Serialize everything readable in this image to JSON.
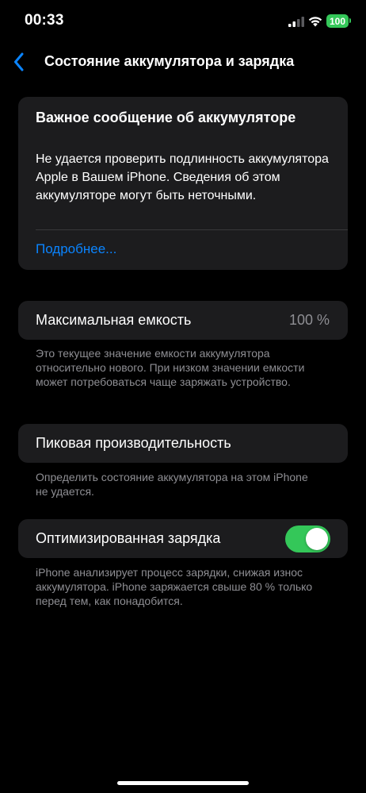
{
  "status_bar": {
    "time": "00:33",
    "battery_level": "100",
    "icons": [
      "signal-icon",
      "wifi-icon",
      "battery-icon"
    ]
  },
  "nav": {
    "back_icon": "chevron-left-icon",
    "title": "Состояние аккумулятора и зарядка"
  },
  "alert": {
    "title": "Важное сообщение об аккумуляторе",
    "body": "Не удается проверить подлинность аккумулятора Apple в Вашем iPhone. Сведения об этом аккумуляторе могут быть неточными.",
    "link": "Подробнее..."
  },
  "capacity": {
    "label": "Максимальная емкость",
    "value": "100 %",
    "note": "Это текущее значение емкости аккумулятора относительно нового. При низком значении емкости может потребоваться чаще заряжать устройство."
  },
  "peak": {
    "label": "Пиковая производительность",
    "note": "Определить состояние аккумулятора на этом iPhone не удается."
  },
  "optimized": {
    "label": "Оптимизированная зарядка",
    "enabled": true,
    "note": "iPhone анализирует процесс зарядки, снижая износ аккумулятора. iPhone заряжается свыше 80 % только перед тем, как понадобится."
  },
  "colors": {
    "accent": "#0a84ff",
    "toggle_on": "#34c759",
    "card_bg": "#1c1c1e",
    "secondary_text": "#8e8e93"
  }
}
